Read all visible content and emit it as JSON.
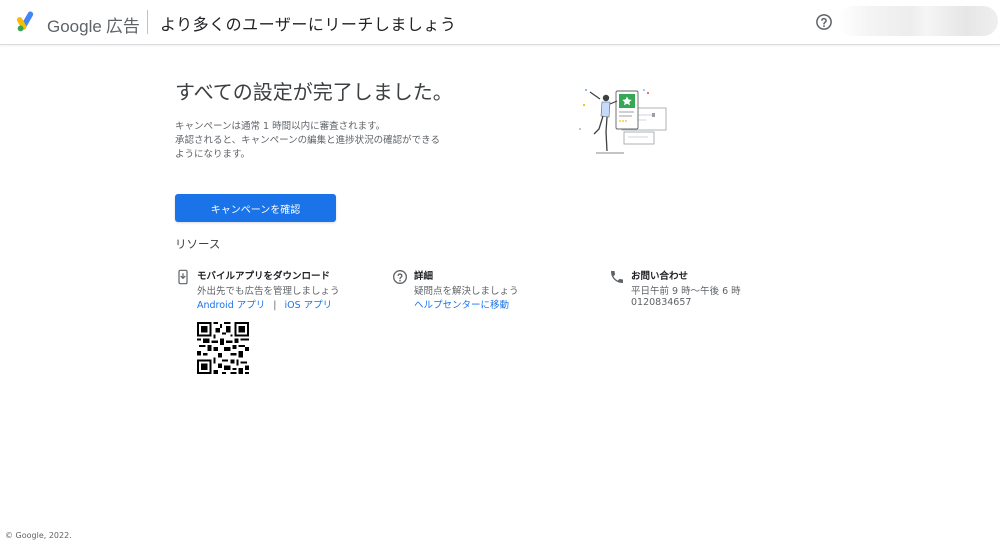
{
  "header": {
    "brand_google": "Google",
    "brand_ads": "広告",
    "title": "より多くのユーザーにリーチしましょう"
  },
  "main": {
    "title": "すべての設定が完了しました。",
    "description": [
      "キャンペーンは通常 1 時間以内に審査されます。",
      "承認されると、キャンペーンの編集と進捗状況の確認ができる",
      "ようになります。"
    ],
    "button_label": "キャンペーンを確認"
  },
  "resources": {
    "heading": "リソース",
    "app": {
      "title": "モバイルアプリをダウンロード",
      "subtitle": "外出先でも広告を管理しましょう",
      "android_link": "Android アプリ",
      "separator": "|",
      "ios_link": "iOS アプリ"
    },
    "details": {
      "title": "詳細",
      "subtitle": "疑問点を解決しましょう",
      "help_link": "ヘルプセンターに移動"
    },
    "contact": {
      "title": "お問い合わせ",
      "hours": "平日午前 9 時〜午後 6 時",
      "phone": "0120834657"
    }
  },
  "footer": {
    "copyright": "© Google, 2022."
  },
  "icons": {
    "logo": "google-ads-logo-icon",
    "help": "help-circle-icon",
    "phone_app": "mobile-download-icon",
    "details": "question-circle-icon",
    "contact": "phone-icon",
    "qr": "qr-code-icon"
  },
  "colors": {
    "accent": "#1a73e8",
    "logo_blue": "#4285f4",
    "logo_yellow": "#fbbc04",
    "logo_green": "#34a853",
    "illustration_green": "#34a853"
  }
}
